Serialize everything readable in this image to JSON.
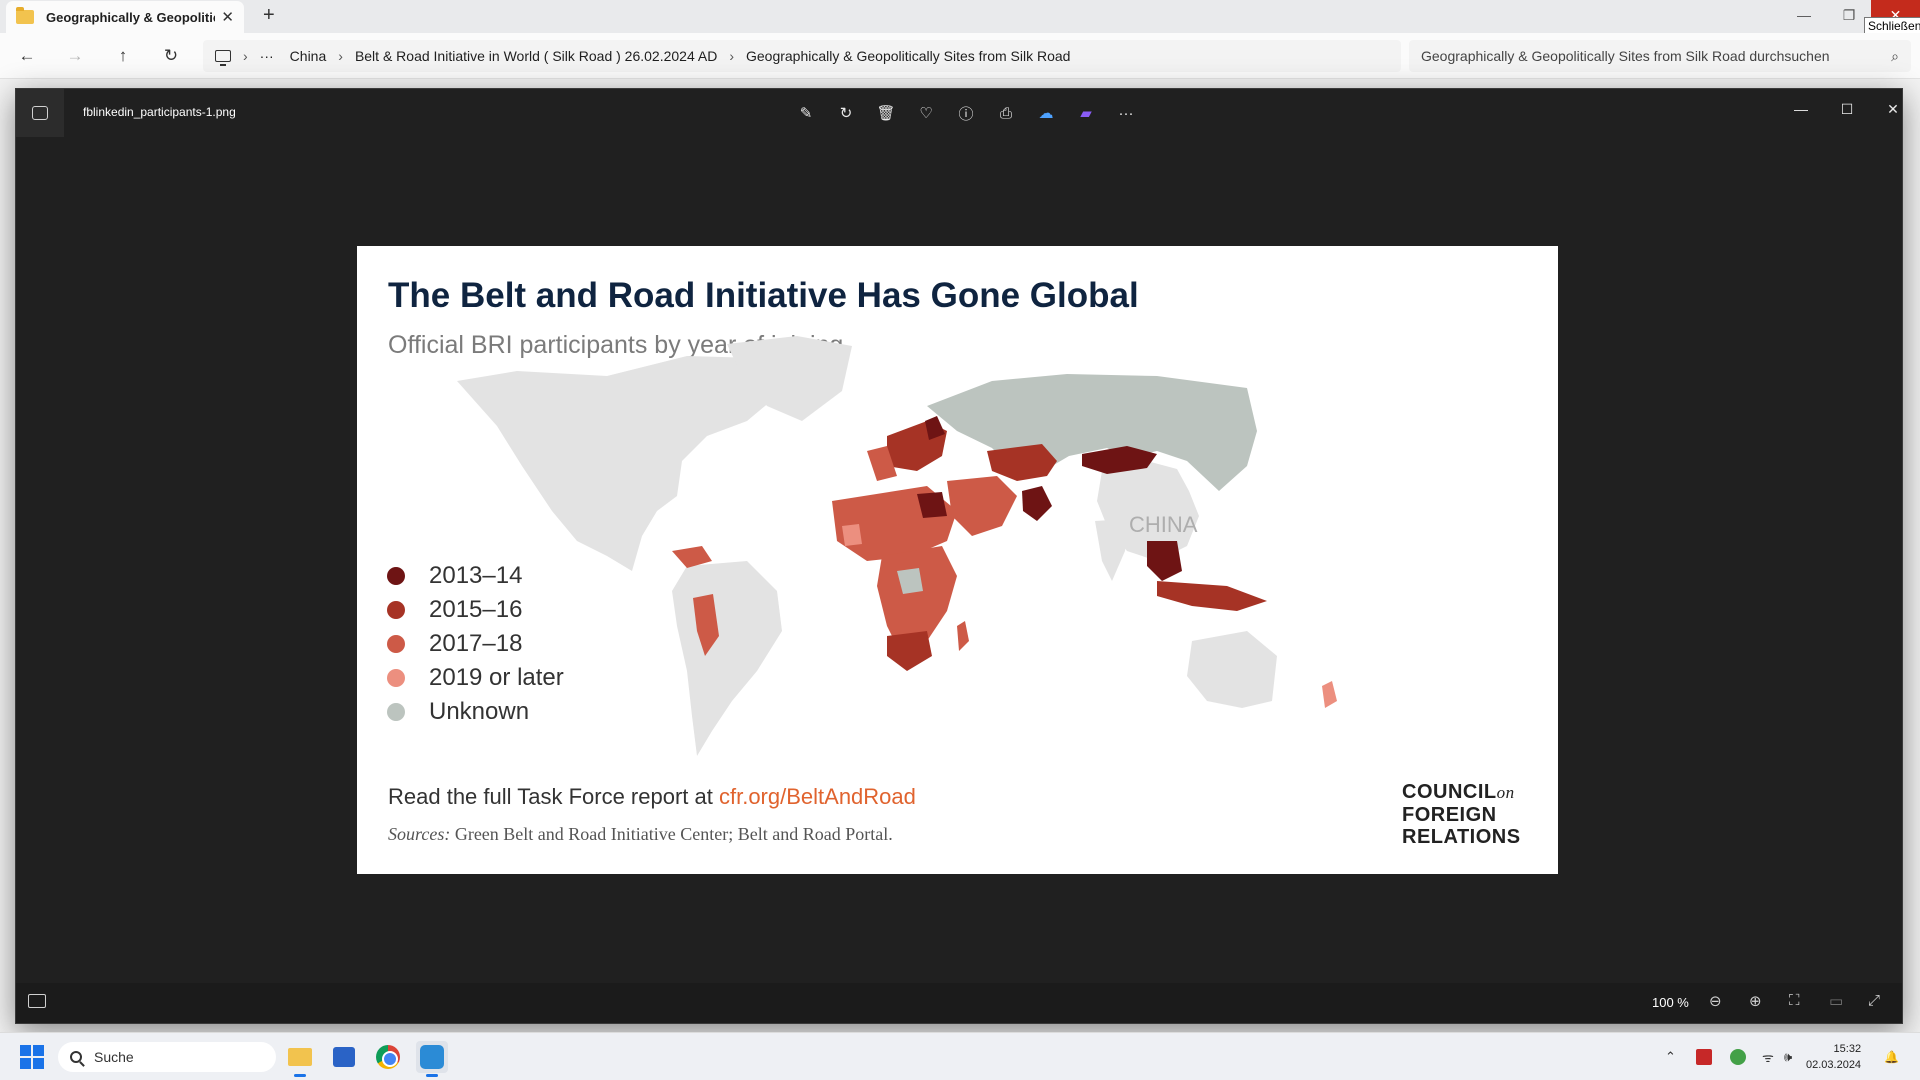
{
  "explorer": {
    "tab_title": "Geographically & Geopoliticall",
    "tab_close": "✕",
    "new_tab": "+",
    "window_controls": {
      "minimize": "—",
      "maximize": "❐",
      "close": "✕"
    },
    "tooltip": "Schließen",
    "nav": {
      "back": "←",
      "forward": "→",
      "up": "↑",
      "refresh": "↻"
    },
    "breadcrumb": {
      "more": "···",
      "segments": [
        "China",
        "Belt & Road Initiative in World ( Silk Road ) 26.02.2024 AD",
        "Geographically & Geopolitically Sites from Silk Road"
      ]
    },
    "search_placeholder": "Geographically & Geopolitically Sites from Silk Road durchsuchen",
    "search_icon": "⌕"
  },
  "viewer": {
    "file_name": "fblinkedin_participants-1.png",
    "toolbar_icons": [
      "edit-icon",
      "rotate-icon",
      "delete-icon",
      "favorite-icon",
      "info-icon",
      "print-icon",
      "onedrive-icon",
      "clipchamp-icon",
      "more-icon"
    ],
    "toolbar_glyphs": [
      "✎",
      "↻",
      "🗑",
      "♡",
      "ⓘ",
      "⎙",
      "☁",
      "▰",
      "···"
    ],
    "window_controls": {
      "minimize": "—",
      "maximize": "☐",
      "close": "✕"
    },
    "zoom_label": "100 %",
    "bottom_glyphs": {
      "zoom_out": "⊖",
      "zoom_in": "⊕",
      "fit": "⛶",
      "actual": "▭",
      "fullscreen": "⤢"
    }
  },
  "graphic": {
    "title": "The Belt and Road Initiative Has Gone Global",
    "subtitle": "Official BRI participants by year of joining",
    "map_label": "CHINA",
    "legend": [
      {
        "label": "2013–14",
        "color": "#6e1414"
      },
      {
        "label": "2015–16",
        "color": "#a63325"
      },
      {
        "label": "2017–18",
        "color": "#cd5a47"
      },
      {
        "label": "2019 or later",
        "color": "#ec8f7f"
      },
      {
        "label": "Unknown",
        "color": "#bcc4bf"
      }
    ],
    "cta_text": "Read the full Task Force report at ",
    "cta_link": "cfr.org/BeltAndRoad",
    "sources_label": "Sources:",
    "sources_text": " Green Belt and Road Initiative Center; Belt and Road Portal.",
    "logo": {
      "line1": "COUNCIL",
      "on": "on",
      "line2": "FOREIGN",
      "line3": "RELATIONS"
    },
    "land_color": "#e3e3e3"
  },
  "taskbar": {
    "search_label": "Suche",
    "tray_chevron": "⌃",
    "tray_icons": [
      "wifi-icon",
      "volume-icon"
    ],
    "tray_glyphs": {
      "wifi": "ᯤ",
      "volume": "🕪",
      "bell": "🔔"
    },
    "time": "15:32",
    "date": "02.03.2024"
  }
}
